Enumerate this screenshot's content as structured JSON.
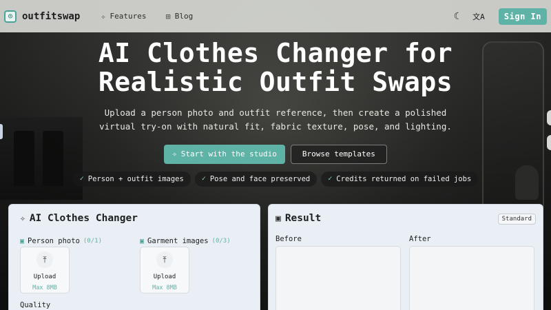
{
  "nav": {
    "logo_text": "outfitswap",
    "links": [
      {
        "label": "Features",
        "icon": "sparkles-icon"
      },
      {
        "label": "Blog",
        "icon": "book-icon"
      }
    ],
    "signin_label": "Sign In"
  },
  "hero": {
    "title_line1": "AI Clothes Changer for",
    "title_line2": "Realistic Outfit Swaps",
    "subtitle_line1": "Upload a person photo and outfit reference, then create a polished",
    "subtitle_line2": "virtual try-on with natural fit, fabric texture, pose, and lighting.",
    "primary_cta": "Start with the studio",
    "secondary_cta": "Browse templates",
    "chips": [
      "Person + outfit images",
      "Pose and face preserved",
      "Credits returned on failed jobs"
    ]
  },
  "changer": {
    "title": "AI Clothes Changer",
    "person_label": "Person photo",
    "person_count": "(0/1)",
    "garment_label": "Garment images",
    "garment_count": "(0/3)",
    "upload_label": "Upload",
    "upload_max": "Max 8MB",
    "quality_label": "Quality"
  },
  "result": {
    "title": "Result",
    "badge": "Standard",
    "before_label": "Before",
    "after_label": "After"
  },
  "colors": {
    "accent": "#5fb3a6",
    "nav_bg": "#d7d8d4",
    "panel_bg": "#e9eff5"
  }
}
